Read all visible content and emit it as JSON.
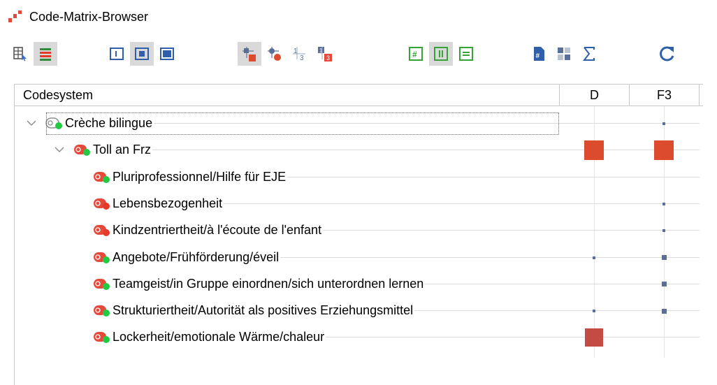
{
  "window": {
    "title": "Code-Matrix-Browser"
  },
  "toolbar": {
    "buttons": [
      {
        "name": "document-grid-icon",
        "active": false
      },
      {
        "name": "colored-rows-icon",
        "active": true
      },
      {
        "name": "view-left-panel-icon",
        "active": false
      },
      {
        "name": "view-center-panel-icon",
        "active": true
      },
      {
        "name": "view-full-panel-icon",
        "active": false
      },
      {
        "name": "symbol-square-icon",
        "active": true
      },
      {
        "name": "symbol-circle-icon",
        "active": false
      },
      {
        "name": "numbers-icon",
        "active": false
      },
      {
        "name": "highlighted-numbers-icon",
        "active": false
      },
      {
        "name": "grid-hash-icon",
        "active": false
      },
      {
        "name": "columns-icon",
        "active": true
      },
      {
        "name": "rows-icon",
        "active": false
      },
      {
        "name": "document-hash-icon",
        "active": false
      },
      {
        "name": "counts-icon",
        "active": false
      },
      {
        "name": "sum-icon",
        "active": false
      },
      {
        "name": "refresh-icon",
        "active": false
      }
    ]
  },
  "matrix": {
    "header": {
      "codesystem": "Codesystem",
      "columns": [
        "D",
        "F3"
      ]
    },
    "rows": [
      {
        "label": "Crèche bilingue",
        "level": 0,
        "expandable": true,
        "icon_dot": "green",
        "icon_type": "gray",
        "D": 0,
        "F3": 1,
        "focused": true
      },
      {
        "label": "Toll an Frz",
        "level": 1,
        "expandable": true,
        "icon_dot": "green",
        "icon_type": "red",
        "D": 4,
        "F3": 4
      },
      {
        "label": "Pluriprofessionnel/Hilfe für EJE",
        "level": 2,
        "expandable": false,
        "icon_dot": "green",
        "icon_type": "red",
        "D": 0,
        "F3": 0
      },
      {
        "label": "Lebensbezogenheit",
        "level": 2,
        "expandable": false,
        "icon_dot": "red",
        "icon_type": "red",
        "D": 0,
        "F3": 1
      },
      {
        "label": "Kindzentriertheit/à l'écoute de l'enfant",
        "level": 2,
        "expandable": false,
        "icon_dot": "red",
        "icon_type": "red",
        "D": 0,
        "F3": 1
      },
      {
        "label": "Angebote/Frühförderung/éveil",
        "level": 2,
        "expandable": false,
        "icon_dot": "green",
        "icon_type": "red",
        "D": 1,
        "F3": 2
      },
      {
        "label": "Teamgeist/in Gruppe einordnen/sich unterordnen lernen",
        "level": 2,
        "expandable": false,
        "icon_dot": "green",
        "icon_type": "red",
        "D": 0,
        "F3": 2
      },
      {
        "label": "Strukturiertheit/Autorität als positives Erziehungsmittel",
        "level": 2,
        "expandable": false,
        "icon_dot": "green",
        "icon_type": "red",
        "D": 1,
        "F3": 2
      },
      {
        "label": "Lockerheit/emotionale Wärme/chaleur",
        "level": 2,
        "expandable": false,
        "icon_dot": "green",
        "icon_type": "red",
        "D": 3,
        "F3": 0
      }
    ]
  },
  "colors": {
    "square_small": "#5a6e9a",
    "square_large": "#dd4b2e",
    "square_large_alt": "#c44b43",
    "code_red": "#e5493a",
    "code_gray": "#909090",
    "dot_green": "#22c943",
    "dot_red": "#e53a2a"
  }
}
